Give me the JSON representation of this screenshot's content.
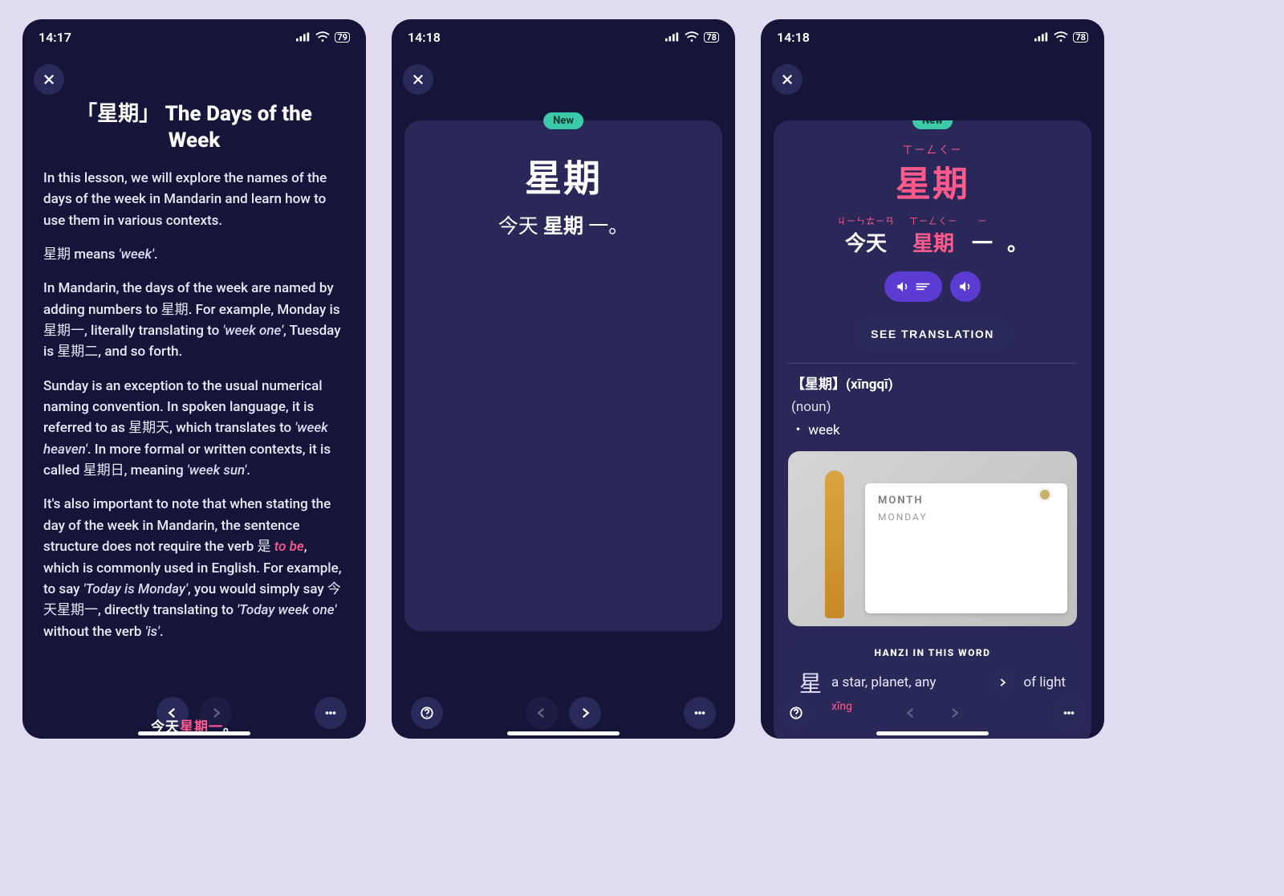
{
  "status": {
    "time1": "14:17",
    "time2": "14:18",
    "time3": "14:18",
    "battery1": "79",
    "battery2": "78",
    "battery3": "78"
  },
  "screen1": {
    "title": "「星期」 The Days of the Week",
    "intro": "In this lesson, we will explore the names of the days of the week in Mandarin and learn how to use them in various contexts.",
    "p_week_pre": "星期 means ",
    "p_week_em": "'week'",
    "p_week_post": ".",
    "p_named": "In Mandarin, the days of the week are named by adding numbers to 星期. For example, Monday is 星期一, literally translating to ",
    "p_named_em1": "'week one'",
    "p_named_mid": ", Tuesday is 星期二, and so forth.",
    "p_sunday1": "Sunday is an exception to the usual numerical naming convention. In spoken language, it is referred to as 星期天, which translates to ",
    "p_sunday_em1": "'week heaven'",
    "p_sunday2": ". In more formal or written contexts, it is called 星期日, meaning ",
    "p_sunday_em2": "'week sun'",
    "p_sunday3": ".",
    "p_note1": "It's also important to note that when stating the day of the week in Mandarin, the sentence structure does not require the verb 是 ",
    "p_note_tobe": "to be",
    "p_note2": ", which is commonly used in English. For example, to say ",
    "p_note_em1": "'Today is Monday'",
    "p_note3": ", you would simply say 今天星期一, directly translating to ",
    "p_note_em2": "'Today week one'",
    "p_note4": " without the verb ",
    "p_note_em3": "'is'",
    "p_note5": ".",
    "caption_a": "今天",
    "caption_b": "星期一",
    "caption_c": "。"
  },
  "screen2": {
    "new_label": "New",
    "hanzi": "星期",
    "sentence_a": "今天 ",
    "sentence_b": "星期",
    "sentence_c": " 一。"
  },
  "screen3": {
    "new_label": "New",
    "pinyin_top": "ㄒㄧㄥㄑㄧ",
    "hanzi": "星期",
    "line2": {
      "c1_py": "ㄐㄧㄣㄊㄧㄢ",
      "c1_hz": "今天",
      "c2_py": "ㄒㄧㄥㄑㄧ",
      "c2_hz": "星期",
      "c3_py": "ㄧ",
      "c3_hz": "一",
      "tail": "。"
    },
    "see_translation": "SEE TRANSLATION",
    "dict_head": "【星期】(xīngqī)",
    "dict_pos": "(noun)",
    "dict_def": "・ week",
    "image": {
      "month": "MONTH",
      "day": "MONDAY"
    },
    "hanzi_in_word": "HANZI IN THIS WORD",
    "component": {
      "glyph": "星",
      "gloss_a": "a star, planet, any",
      "gloss_b": "of light",
      "pinyin": "xīng"
    }
  }
}
